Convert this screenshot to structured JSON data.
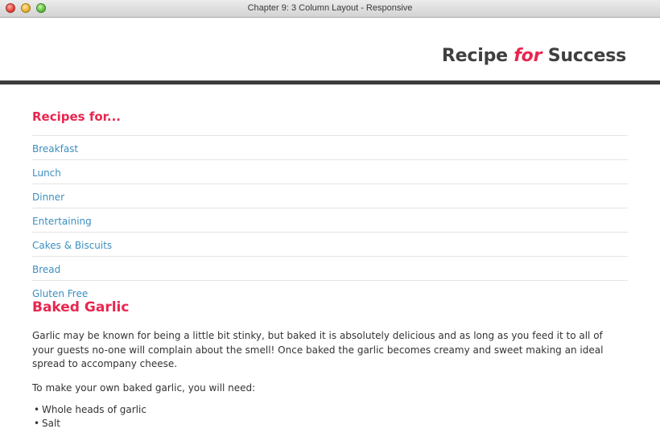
{
  "window": {
    "title": "Chapter 9: 3 Column Layout - Responsive"
  },
  "site": {
    "logo_part1": "Recipe ",
    "logo_accent": "for",
    "logo_part2": " Success",
    "accent_color": "#e8264f",
    "link_color": "#3c8fbf"
  },
  "sidebar": {
    "heading": "Recipes for...",
    "items": [
      {
        "label": "Breakfast"
      },
      {
        "label": "Lunch"
      },
      {
        "label": "Dinner"
      },
      {
        "label": "Entertaining"
      },
      {
        "label": "Cakes & Biscuits"
      },
      {
        "label": "Bread"
      },
      {
        "label": "Gluten Free"
      }
    ]
  },
  "article": {
    "title": "Baked Garlic",
    "intro": "Garlic may be known for being a little bit stinky, but baked it is absolutely delicious and as long as you feed it to all of your guests no-one will complain about the smell! Once baked the garlic becomes creamy and sweet making an ideal spread to accompany cheese.",
    "need_text": "To make your own baked garlic, you will need:",
    "ingredients": [
      "Whole heads of garlic",
      "Salt"
    ]
  }
}
